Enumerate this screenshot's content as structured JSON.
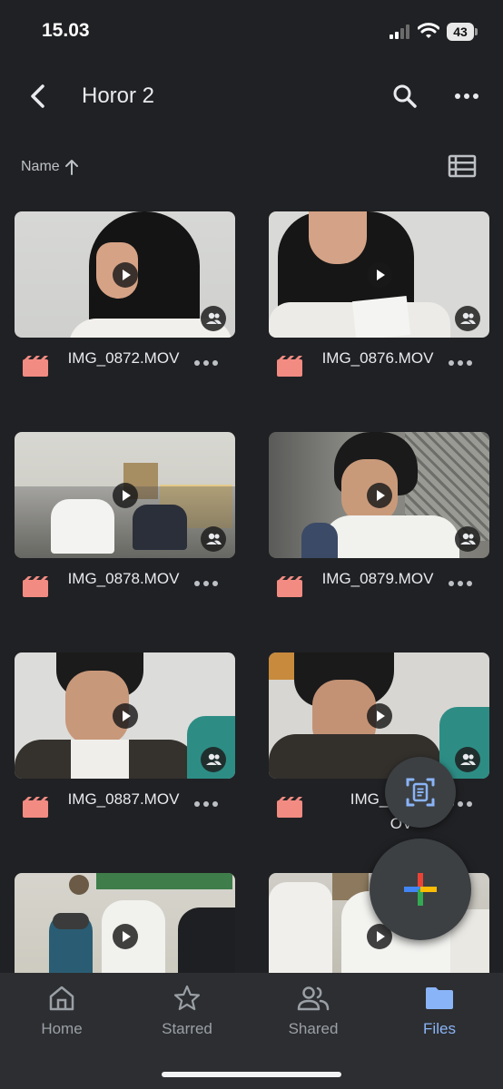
{
  "status_bar": {
    "time": "15.03",
    "battery": "43"
  },
  "header": {
    "title": "Horor 2"
  },
  "sort": {
    "label": "Name"
  },
  "files": [
    {
      "name": "IMG_0872.MOV"
    },
    {
      "name": "IMG_0876.MOV"
    },
    {
      "name": "IMG_0878.MOV"
    },
    {
      "name": "IMG_0879.MOV"
    },
    {
      "name": "IMG_0887.MOV"
    },
    {
      "name": "IMG_08"
    },
    {
      "name": ""
    },
    {
      "name": ""
    }
  ],
  "file_name_tail_5": "OV",
  "nav": {
    "home": "Home",
    "starred": "Starred",
    "shared": "Shared",
    "files": "Files"
  },
  "colors": {
    "background": "#202124",
    "accent": "#8ab4f8",
    "video_icon": "#f28b82",
    "nav_bg": "#2d2e31"
  },
  "icons": [
    "back-arrow-icon",
    "search-icon",
    "more-vert-icon",
    "sort-up-arrow-icon",
    "list-view-icon",
    "play-icon",
    "shared-people-icon",
    "video-file-icon",
    "more-horiz-icon",
    "document-scan-icon",
    "plus-icon",
    "home-icon",
    "star-icon",
    "people-icon",
    "folder-icon"
  ]
}
